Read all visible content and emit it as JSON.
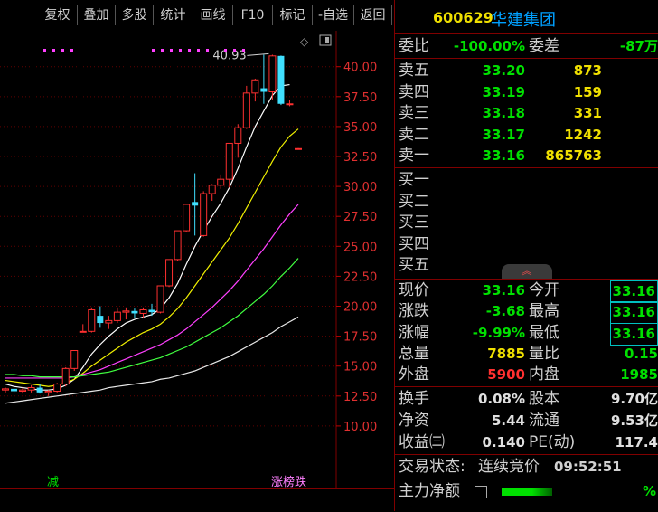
{
  "toolbar": {
    "buttons": [
      "复权",
      "叠加",
      "多股",
      "统计",
      "画线",
      "F10",
      "标记",
      "-自选",
      "返回"
    ]
  },
  "stock": {
    "code": "600629",
    "name": "华建集团"
  },
  "chart_data": {
    "type": "candlestick",
    "y_ticks": [
      "40.00",
      "37.50",
      "35.00",
      "32.50",
      "30.00",
      "27.50",
      "25.00",
      "22.50",
      "20.00",
      "17.50",
      "15.00",
      "12.50",
      "10.00"
    ],
    "ylim": [
      7.5,
      43.0
    ],
    "high_label": "40.93",
    "x": [
      1,
      2,
      3,
      4,
      5,
      6,
      7,
      8,
      9,
      10,
      11,
      12,
      13,
      14,
      15,
      16,
      17,
      18,
      19,
      20,
      21,
      22,
      23,
      24,
      25,
      26,
      27,
      28,
      29,
      30,
      31,
      32,
      33,
      34,
      35
    ],
    "candles": [
      [
        13.0,
        13.2,
        12.8,
        13.1
      ],
      [
        13.1,
        13.3,
        12.8,
        12.9
      ],
      [
        12.9,
        13.2,
        12.7,
        13.0
      ],
      [
        13.0,
        13.4,
        12.8,
        13.2
      ],
      [
        13.2,
        13.5,
        12.7,
        12.8
      ],
      [
        12.8,
        13.0,
        12.5,
        12.9
      ],
      [
        12.9,
        13.6,
        12.8,
        13.5
      ],
      [
        13.5,
        14.9,
        13.3,
        14.8
      ],
      [
        14.8,
        16.3,
        14.6,
        16.3
      ],
      [
        17.9,
        18.5,
        17.9,
        17.9
      ],
      [
        17.9,
        19.9,
        17.8,
        19.7
      ],
      [
        19.2,
        20.0,
        18.2,
        18.6
      ],
      [
        18.6,
        19.2,
        18.1,
        18.8
      ],
      [
        18.8,
        19.9,
        18.6,
        19.5
      ],
      [
        19.5,
        19.9,
        18.9,
        19.6
      ],
      [
        19.6,
        19.8,
        19.0,
        19.4
      ],
      [
        19.4,
        19.9,
        19.0,
        19.7
      ],
      [
        19.7,
        20.2,
        19.2,
        19.5
      ],
      [
        19.5,
        21.7,
        19.4,
        21.7
      ],
      [
        21.7,
        23.9,
        21.6,
        23.9
      ],
      [
        23.9,
        26.3,
        23.8,
        26.3
      ],
      [
        26.3,
        28.5,
        26.2,
        28.5
      ],
      [
        28.7,
        31.1,
        25.9,
        28.4
      ],
      [
        25.9,
        29.6,
        25.8,
        29.4
      ],
      [
        29.4,
        30.2,
        28.8,
        30.1
      ],
      [
        30.1,
        31.0,
        29.8,
        30.6
      ],
      [
        30.6,
        33.6,
        29.9,
        33.6
      ],
      [
        33.6,
        35.2,
        32.4,
        34.9
      ],
      [
        34.9,
        38.4,
        34.8,
        37.8
      ],
      [
        37.8,
        39.0,
        37.1,
        38.9
      ],
      [
        38.2,
        41.0,
        36.9,
        37.9
      ],
      [
        37.9,
        41.0,
        37.2,
        40.9
      ],
      [
        40.9,
        40.93,
        36.8,
        36.9
      ],
      [
        36.9,
        37.2,
        36.7,
        36.9
      ],
      [
        33.16,
        33.2,
        33.1,
        33.16
      ]
    ],
    "ma_lines": [
      {
        "name": "white",
        "color": "#ffffff",
        "values": [
          13.5,
          13.3,
          13.2,
          13.1,
          13.0,
          13.0,
          13.1,
          13.4,
          13.9,
          14.9,
          16.0,
          16.8,
          17.5,
          18.1,
          18.6,
          18.9,
          19.1,
          19.3,
          19.8,
          20.7,
          21.9,
          23.5,
          25.0,
          26.3,
          27.5,
          28.6,
          29.9,
          31.5,
          33.3,
          35.0,
          36.3,
          37.6,
          38.4,
          38.5
        ]
      },
      {
        "name": "yellow",
        "color": "#f0f000",
        "values": [
          13.8,
          13.7,
          13.6,
          13.5,
          13.4,
          13.3,
          13.4,
          13.6,
          13.9,
          14.4,
          15.0,
          15.5,
          16.0,
          16.5,
          17.0,
          17.4,
          17.8,
          18.1,
          18.5,
          19.1,
          19.8,
          20.7,
          21.7,
          22.7,
          23.7,
          24.7,
          25.7,
          26.9,
          28.2,
          29.5,
          30.8,
          32.1,
          33.3,
          34.2,
          34.8
        ]
      },
      {
        "name": "magenta",
        "color": "#ff40ff",
        "values": [
          14.0,
          14.0,
          14.0,
          14.0,
          14.0,
          14.0,
          14.0,
          14.0,
          14.1,
          14.3,
          14.5,
          14.7,
          15.0,
          15.3,
          15.6,
          15.9,
          16.2,
          16.5,
          16.8,
          17.2,
          17.6,
          18.1,
          18.7,
          19.3,
          19.9,
          20.6,
          21.3,
          22.1,
          23.0,
          23.9,
          24.8,
          25.8,
          26.8,
          27.7,
          28.5
        ]
      },
      {
        "name": "green",
        "color": "#40ff40",
        "values": [
          14.3,
          14.3,
          14.2,
          14.2,
          14.1,
          14.1,
          14.1,
          14.1,
          14.1,
          14.2,
          14.3,
          14.4,
          14.5,
          14.7,
          14.9,
          15.1,
          15.3,
          15.5,
          15.7,
          16.0,
          16.3,
          16.6,
          17.0,
          17.4,
          17.8,
          18.2,
          18.7,
          19.2,
          19.8,
          20.4,
          21.0,
          21.7,
          22.5,
          23.2,
          24.0
        ]
      },
      {
        "name": "gray",
        "color": "#e8e8e8",
        "values": [
          11.9,
          12.0,
          12.1,
          12.2,
          12.3,
          12.4,
          12.5,
          12.6,
          12.7,
          12.8,
          12.9,
          13.0,
          13.2,
          13.3,
          13.4,
          13.5,
          13.6,
          13.7,
          13.9,
          14.0,
          14.2,
          14.4,
          14.6,
          14.9,
          15.2,
          15.5,
          15.8,
          16.2,
          16.6,
          17.0,
          17.4,
          17.8,
          18.3,
          18.7,
          19.1
        ]
      }
    ]
  },
  "chart_labels": {
    "bottom_left": "减",
    "bottom_right": "涨榜跌"
  },
  "quote": {
    "weibi_label": "委比",
    "weibi": "-100.00%",
    "weicha_label": "委差",
    "weicha": "-87万",
    "sell": [
      {
        "label": "卖五",
        "price": "33.20",
        "vol": "873"
      },
      {
        "label": "卖四",
        "price": "33.19",
        "vol": "159"
      },
      {
        "label": "卖三",
        "price": "33.18",
        "vol": "331"
      },
      {
        "label": "卖二",
        "price": "33.17",
        "vol": "1242"
      },
      {
        "label": "卖一",
        "price": "33.16",
        "vol": "865763"
      }
    ],
    "buy": [
      "买一",
      "买二",
      "买三",
      "买四",
      "买五"
    ],
    "stats": [
      {
        "l1": "现价",
        "v1": "33.16",
        "l2": "今开",
        "v2": "33.16"
      },
      {
        "l1": "涨跌",
        "v1": "-3.68",
        "l2": "最高",
        "v2": "33.16"
      },
      {
        "l1": "涨幅",
        "v1": "-9.99%",
        "l2": "最低",
        "v2": "33.16"
      },
      {
        "l1": "总量",
        "v1": "7885",
        "l2": "量比",
        "v2": "0.15"
      },
      {
        "l1": "外盘",
        "v1": "5900",
        "l2": "内盘",
        "v2": "1985"
      }
    ],
    "fund": [
      {
        "l1": "换手",
        "v1": "0.08%",
        "l2": "股本",
        "v2": "9.70亿"
      },
      {
        "l1": "净资",
        "v1": "5.44",
        "l2": "流通",
        "v2": "9.53亿"
      },
      {
        "l1": "收益㈢",
        "v1": "0.140",
        "l2": "PE(动)",
        "v2": "117.4"
      }
    ],
    "status_label": "交易状态:",
    "status": "连续竞价",
    "time": "09:52:51",
    "main_net_label": "主力净额",
    "main_net_unit": "%"
  }
}
